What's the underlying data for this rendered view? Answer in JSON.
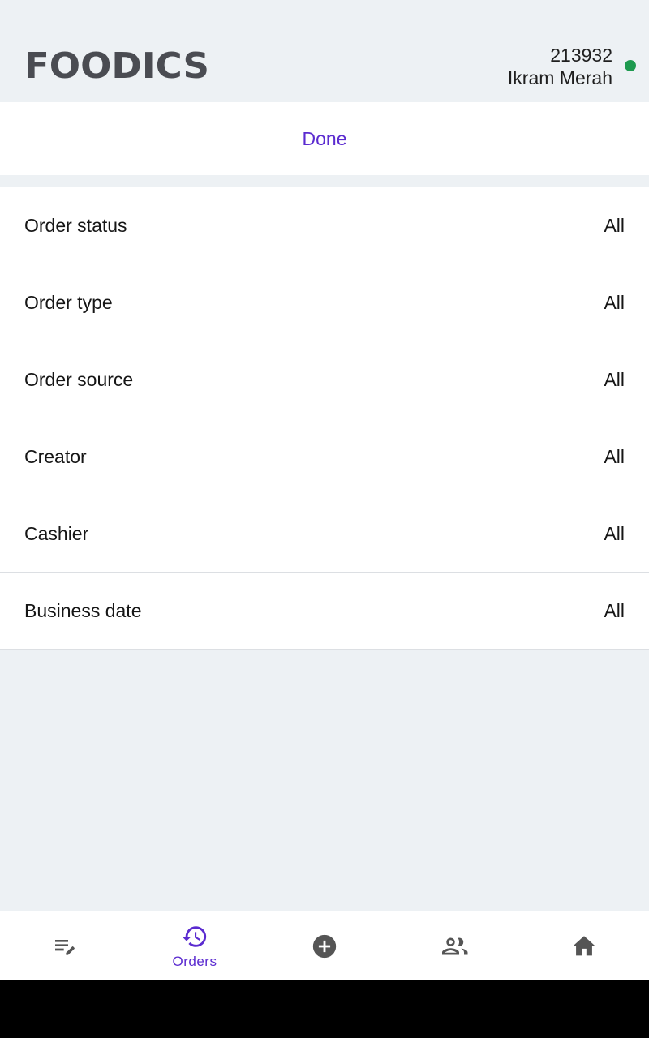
{
  "header": {
    "brand": "FOODICS",
    "user_id": "213932",
    "user_name": "Ikram Merah",
    "status_color": "#1e9a4f"
  },
  "done_label": "Done",
  "filters": [
    {
      "label": "Order status",
      "value": "All"
    },
    {
      "label": "Order type",
      "value": "All"
    },
    {
      "label": "Order source",
      "value": "All"
    },
    {
      "label": "Creator",
      "value": "All"
    },
    {
      "label": "Cashier",
      "value": "All"
    },
    {
      "label": "Business date",
      "value": "All"
    }
  ],
  "tabs": [
    {
      "icon": "edit-list-icon",
      "label": ""
    },
    {
      "icon": "history-icon",
      "label": "Orders",
      "active": true
    },
    {
      "icon": "add-circle-icon",
      "label": ""
    },
    {
      "icon": "people-icon",
      "label": ""
    },
    {
      "icon": "home-icon",
      "label": ""
    }
  ],
  "colors": {
    "accent": "#5b2bd0",
    "icon_gray": "#555555",
    "background": "#edf1f4"
  }
}
